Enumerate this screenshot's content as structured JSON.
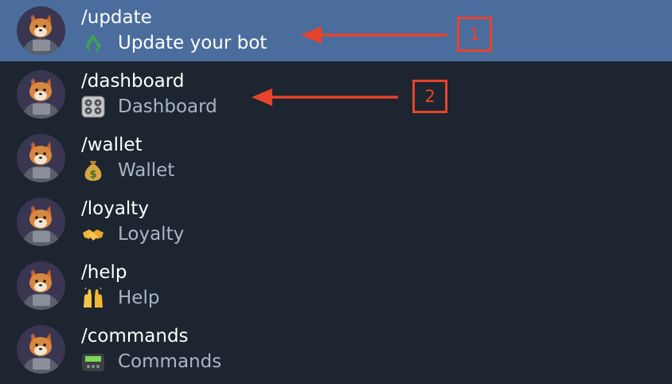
{
  "commands": [
    {
      "command": "/update",
      "description": "Update your bot",
      "emoji": "recycle-icon",
      "selected": true
    },
    {
      "command": "/dashboard",
      "description": "Dashboard",
      "emoji": "control-knobs-icon",
      "selected": false
    },
    {
      "command": "/wallet",
      "description": "Wallet",
      "emoji": "money-bag-icon",
      "selected": false
    },
    {
      "command": "/loyalty",
      "description": "Loyalty",
      "emoji": "handshake-icon",
      "selected": false
    },
    {
      "command": "/help",
      "description": "Help",
      "emoji": "raising-hands-icon",
      "selected": false
    },
    {
      "command": "/commands",
      "description": "Commands",
      "emoji": "pager-icon",
      "selected": false
    }
  ],
  "annotations": [
    {
      "label": "1"
    },
    {
      "label": "2"
    }
  ],
  "colors": {
    "background": "#1c2530",
    "selected_row": "#4a6d9d",
    "command_text": "#ffffff",
    "description_text": "#aab6c4",
    "annotation": "#e8432b"
  }
}
